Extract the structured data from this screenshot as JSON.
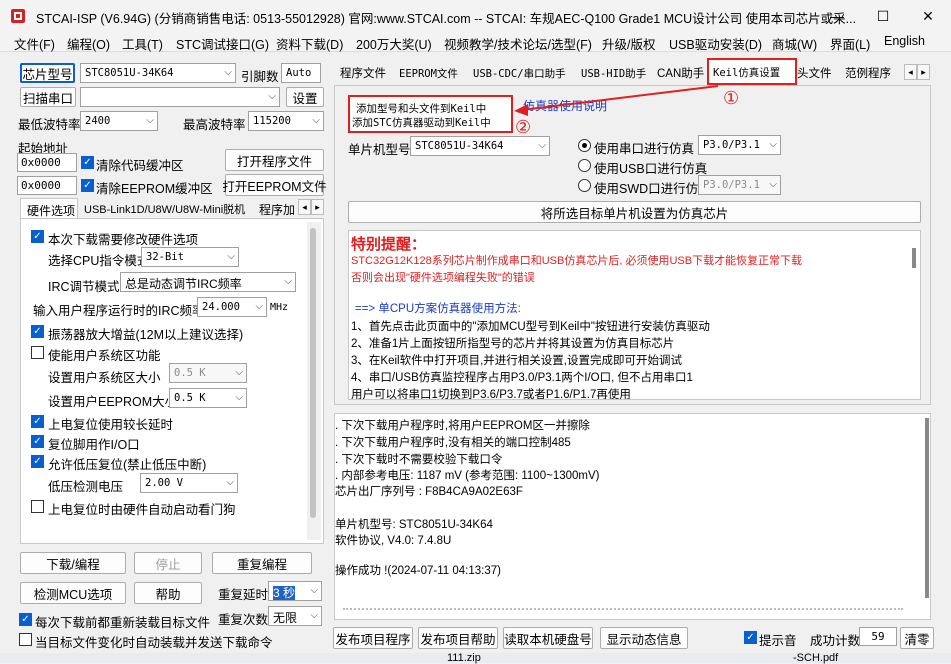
{
  "window": {
    "title": "STCAI-ISP (V6.94G) (分销商销售电话: 0513-55012928) 官网:www.STCAI.com  -- STCAI: 车规AEC-Q100 Grade1 MCU设计公司 使用本司芯片或采...",
    "minimize_label": "—",
    "maximize_label": "☐",
    "close_label": "✕"
  },
  "menu": [
    "文件(F)",
    "编程(O)",
    "工具(T)",
    "STC调试接口(G)",
    "资料下载(D)",
    "200万大奖(U)",
    "视频教学/技术论坛/选型(F)",
    "升级/版权",
    "USB驱动安装(D)",
    "商城(W)",
    "界面(L)",
    "English"
  ],
  "left": {
    "chip_type_button": "芯片型号",
    "chip_type_value": "STC8051U-34K64",
    "pin_label": "引脚数",
    "pin_value": "Auto",
    "scan_port_button": "扫描串口",
    "port_value": "",
    "settings_button": "设置",
    "min_baud_label": "最低波特率",
    "min_baud_value": "2400",
    "max_baud_label": "最高波特率",
    "max_baud_value": "115200",
    "start_addr_label": "起始地址",
    "addr1": "0x0000",
    "clear_code_label": "清除代码缓冲区",
    "open_program_button": "打开程序文件",
    "addr2": "0x0000",
    "clear_eeprom_label": "清除EEPROM缓冲区",
    "open_eeprom_button": "打开EEPROM文件",
    "subtabs": [
      "硬件选项",
      "USB-Link1D/U8W/U8W-Mini脱机",
      "程序加"
    ],
    "hw_options": {
      "modify_hw": "本次下载需要修改硬件选项",
      "cpu_mode_label": "选择CPU指令模式",
      "cpu_mode_value": "32-Bit",
      "irc_mode_label": "IRC调节模式",
      "irc_mode_value": "总是动态调节IRC频率",
      "irc_freq_label": "输入用户程序运行时的IRC频率",
      "irc_freq_value": "24.000",
      "irc_freq_unit": "MHz",
      "osc_gain": "振荡器放大增益(12M以上建议选择)",
      "user_sys_area": "使能用户系统区功能",
      "sys_area_size_label": "设置用户系统区大小",
      "sys_area_size_value": "0.5 K",
      "eeprom_size_label": "设置用户EEPROM大小",
      "eeprom_size_value": "0.5 K",
      "long_reset_delay": "上电复位使用较长延时",
      "reset_pin_io": "复位脚用作I/O口",
      "low_voltage_reset": "允许低压复位(禁止低压中断)",
      "lv_detect_label": "低压检测电压",
      "lv_detect_value": "2.00 V",
      "watchdog": "上电复位时由硬件自动启动看门狗"
    },
    "download_button": "下载/编程",
    "stop_button": "停止",
    "reprogram_button": "重复编程",
    "detect_button": "检测MCU选项",
    "help_button": "帮助",
    "repeat_delay_label": "重复延时",
    "repeat_delay_value": "3 秒",
    "repeat_count_label": "重复次数",
    "repeat_count_value": "无限",
    "reload_label": "每次下载前都重新装载目标文件",
    "auto_send_label": "当目标文件变化时自动装载并发送下载命令"
  },
  "right": {
    "tabs": [
      "程序文件",
      "EEPROM文件",
      "USB-CDC/串口助手",
      "USB-HID助手",
      "CAN助手",
      "Keil仿真设置",
      "头文件",
      "范例程序"
    ],
    "active_tab": "Keil仿真设置",
    "keil": {
      "add_header_button_line1": "添加型号和头文件到Keil中",
      "add_header_button_line2": "添加STC仿真器驱动到Keil中",
      "emulator_link": "仿真器使用说明",
      "mcu_label": "单片机型号",
      "mcu_value": "STC8051U-34K64",
      "uart_debug": "使用串口进行仿真",
      "uart_port": "P3.0/P3.1",
      "usb_debug": "使用USB口进行仿真",
      "swd_debug": "使用SWD口进行仿真",
      "swd_port": "P3.0/P3.1",
      "set_emulator_button": "将所选目标单片机设置为仿真芯片",
      "notice_title": "特别提醒：",
      "notice_lines": [
        "STC32G12K128系列芯片制作成串口和USB仿真芯片后, 必须使用USB下载才能恢复正常下载",
        "否则会出现\"硬件选项编程失败\"的错误"
      ],
      "method_title": "==> 单CPU方案仿真器使用方法:",
      "method_lines": [
        "1、首先点击此页面中的\"添加MCU型号到Keil中\"按钮进行安装仿真驱动",
        "2、准备1片上面按钮所指型号的芯片并将其设置为仿真目标芯片",
        "3、在Keil软件中打开项目,并进行相关设置,设置完成即可开始调试",
        "4、串口/USB仿真监控程序占用P3.0/P3.1两个I/O口, 但不占用串口1",
        "   用户可以将串口1切换到P3.6/P3.7或者P1.6/P1.7再使用"
      ],
      "annotation_1": "①",
      "annotation_2": "②"
    },
    "log_lines": [
      " . 下次下载用户程序时,将用户EEPROM区一并擦除",
      " . 下次下载用户程序时,没有相关的端口控制485",
      " . 下次下载时不需要校验下载口令",
      " . 内部参考电压: 1187 mV (参考范围: 1100~1300mV)",
      "芯片出厂序列号 : F8B4CA9A02E63F",
      "",
      "  单片机型号: STC8051U-34K64",
      "  软件协议, V4.0: 7.4.8U",
      "",
      "操作成功 !(2024-07-11 04:13:37)"
    ],
    "publish_program_button": "发布项目程序",
    "publish_help_button": "发布项目帮助",
    "read_disk_button": "读取本机硬盘号",
    "show_dynamic_button": "显示动态信息",
    "beep_label": "提示音",
    "success_count_label": "成功计数",
    "success_count_value": "59",
    "clear_button": "清零"
  },
  "taskbar_peek": [
    "111.zip",
    "-SCH.pdf"
  ],
  "colors": {
    "accent_red": "#e02020",
    "link_blue": "#1a3cc8",
    "check_blue": "#0a5fd0"
  }
}
